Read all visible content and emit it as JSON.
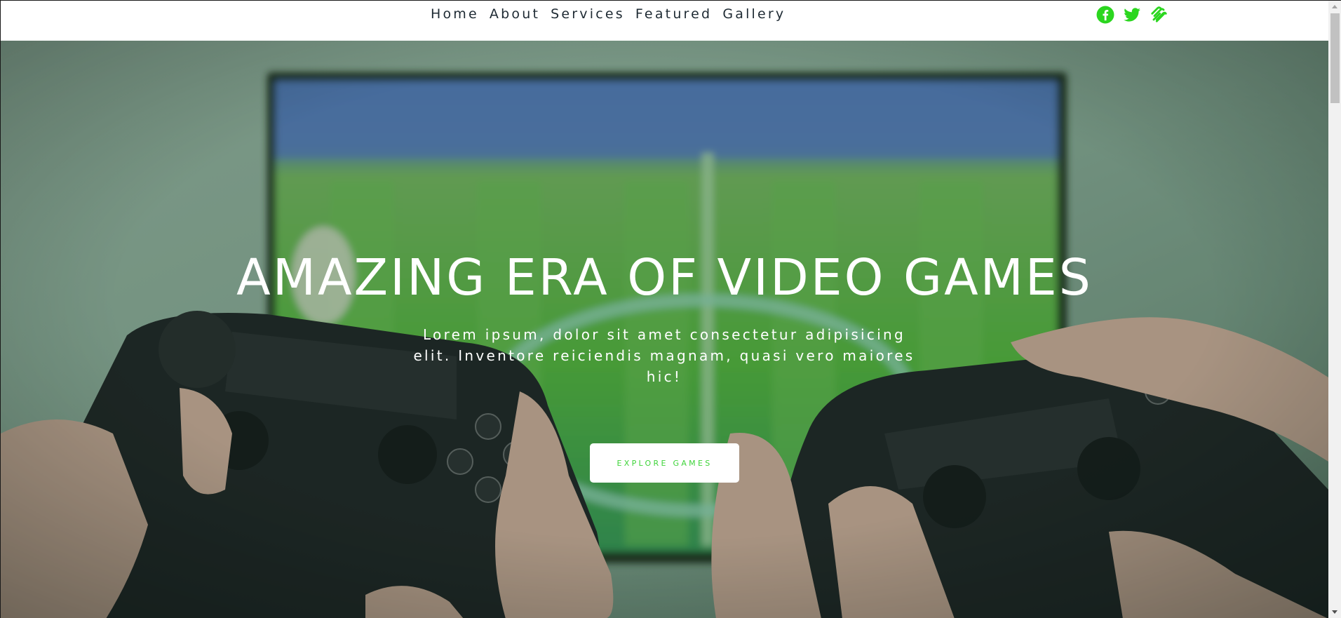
{
  "nav": {
    "items": [
      {
        "label": "Home"
      },
      {
        "label": "About"
      },
      {
        "label": "Services"
      },
      {
        "label": "Featured"
      },
      {
        "label": "Gallery"
      }
    ]
  },
  "social": {
    "icons": [
      "facebook-icon",
      "twitter-icon",
      "squarespace-icon"
    ],
    "color": "#2bd61f"
  },
  "hero": {
    "title": "AMAZING ERA OF VIDEO GAMES",
    "subtitle": "Lorem ipsum, dolor sit amet consectetur adipisicing elit. Inventore reiciendis magnam, quasi vero maiores hic!",
    "button_label": "EXPLORE GAMES",
    "button_text_color": "#3fd43a",
    "image_description_icon": "gamepads-playing-football-game-image"
  },
  "scrollbar": {
    "position_fraction": 0.0
  }
}
